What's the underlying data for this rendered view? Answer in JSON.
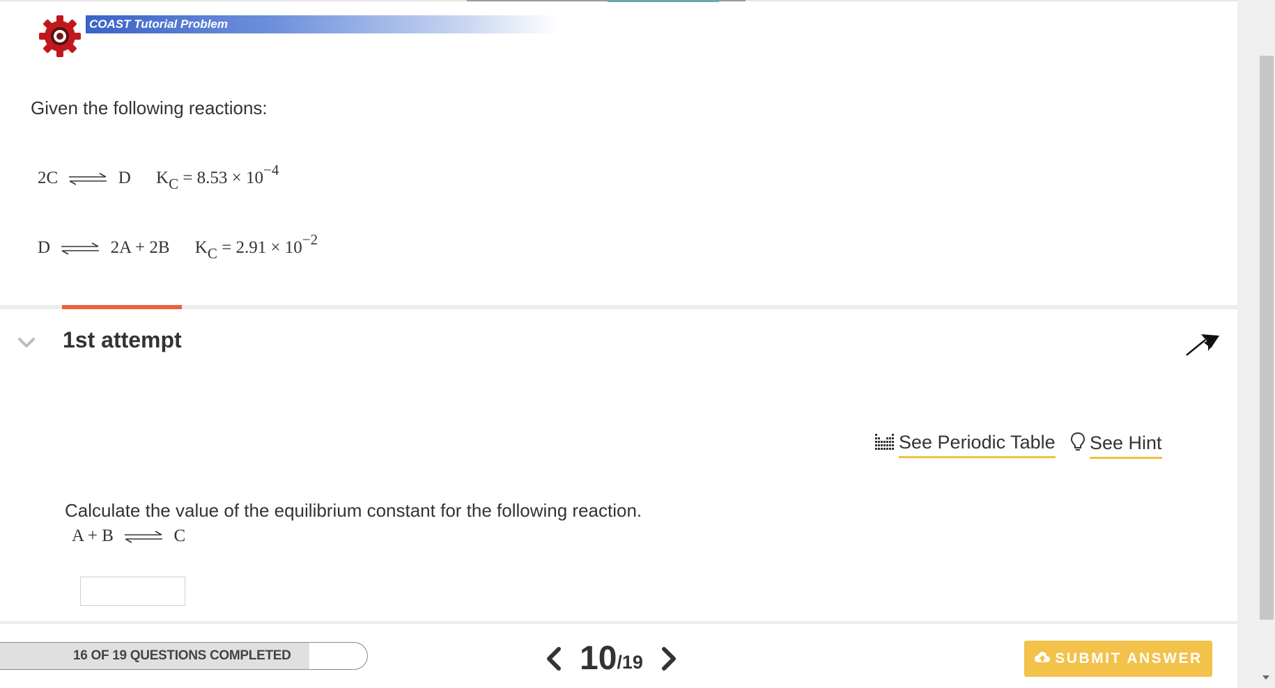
{
  "header": {
    "banner_label": "COAST Tutorial Problem",
    "banner_color": "#3a63c7",
    "logo_color": "#c0181c"
  },
  "problem": {
    "intro": "Given the following reactions:",
    "reactions": [
      {
        "reactants": "2C",
        "products": "D",
        "k_symbol": "K",
        "k_sub": "C",
        "k_value": "= 8.53 × 10",
        "k_exponent": "−4"
      },
      {
        "reactants": "D",
        "products": "2A + 2B",
        "k_symbol": "K",
        "k_sub": "C",
        "k_value": "= 2.91 × 10",
        "k_exponent": "−2"
      }
    ]
  },
  "attempt": {
    "title": "1st attempt",
    "accent_color": "#e8623e"
  },
  "tools": {
    "periodic_label": "See Periodic Table",
    "hint_label": "See Hint",
    "underline_color": "#f0c23c"
  },
  "question": {
    "text": "Calculate the value of the equilibrium constant for the following reaction.",
    "reactants": "A + B",
    "products": "C",
    "answer_value": ""
  },
  "footer": {
    "progress_label": "16 OF 19 QUESTIONS COMPLETED",
    "progress_fraction": 0.8421,
    "current_page": "10",
    "total_pages": "/19",
    "submit_label": "SUBMIT ANSWER",
    "submit_color": "#f2c24a"
  }
}
